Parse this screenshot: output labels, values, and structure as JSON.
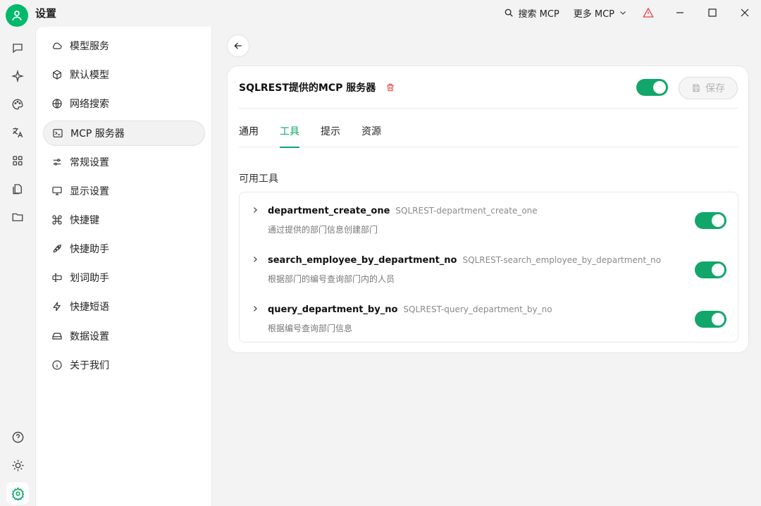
{
  "app": {
    "title": "设置"
  },
  "titlebar": {
    "search_mcp": "搜索 MCP",
    "more_mcp": "更多 MCP"
  },
  "sidebar": {
    "items": [
      {
        "label": "模型服务",
        "icon": "cloud-icon"
      },
      {
        "label": "默认模型",
        "icon": "cube-icon"
      },
      {
        "label": "网络搜索",
        "icon": "globe-icon"
      },
      {
        "label": "MCP 服务器",
        "icon": "terminal-icon",
        "active": true
      },
      {
        "label": "常规设置",
        "icon": "sliders-icon"
      },
      {
        "label": "显示设置",
        "icon": "monitor-icon"
      },
      {
        "label": "快捷键",
        "icon": "command-icon"
      },
      {
        "label": "快捷助手",
        "icon": "rocket-icon"
      },
      {
        "label": "划词助手",
        "icon": "text-cursor-icon"
      },
      {
        "label": "快捷短语",
        "icon": "zap-icon"
      },
      {
        "label": "数据设置",
        "icon": "hard-drive-icon"
      },
      {
        "label": "关于我们",
        "icon": "info-icon"
      }
    ]
  },
  "server": {
    "name": "SQLREST提供的MCP 服务器",
    "enabled": true,
    "save_label": "保存"
  },
  "tabs": [
    {
      "label": "通用",
      "active": false
    },
    {
      "label": "工具",
      "active": true
    },
    {
      "label": "提示",
      "active": false
    },
    {
      "label": "资源",
      "active": false
    }
  ],
  "tools_section": {
    "title": "可用工具",
    "tools": [
      {
        "name": "department_create_one",
        "id": "SQLREST-department_create_one",
        "desc": "通过提供的部门信息创建部门",
        "enabled": true
      },
      {
        "name": "search_employee_by_department_no",
        "id": "SQLREST-search_employee_by_department_no",
        "desc": "根据部门的编号查询部门内的人员",
        "enabled": true
      },
      {
        "name": "query_department_by_no",
        "id": "SQLREST-query_department_by_no",
        "desc": "根据编号查询部门信息",
        "enabled": true
      }
    ]
  },
  "colors": {
    "accent": "#13a66a",
    "avatar": "#00b96b",
    "danger": "#e5484d"
  }
}
